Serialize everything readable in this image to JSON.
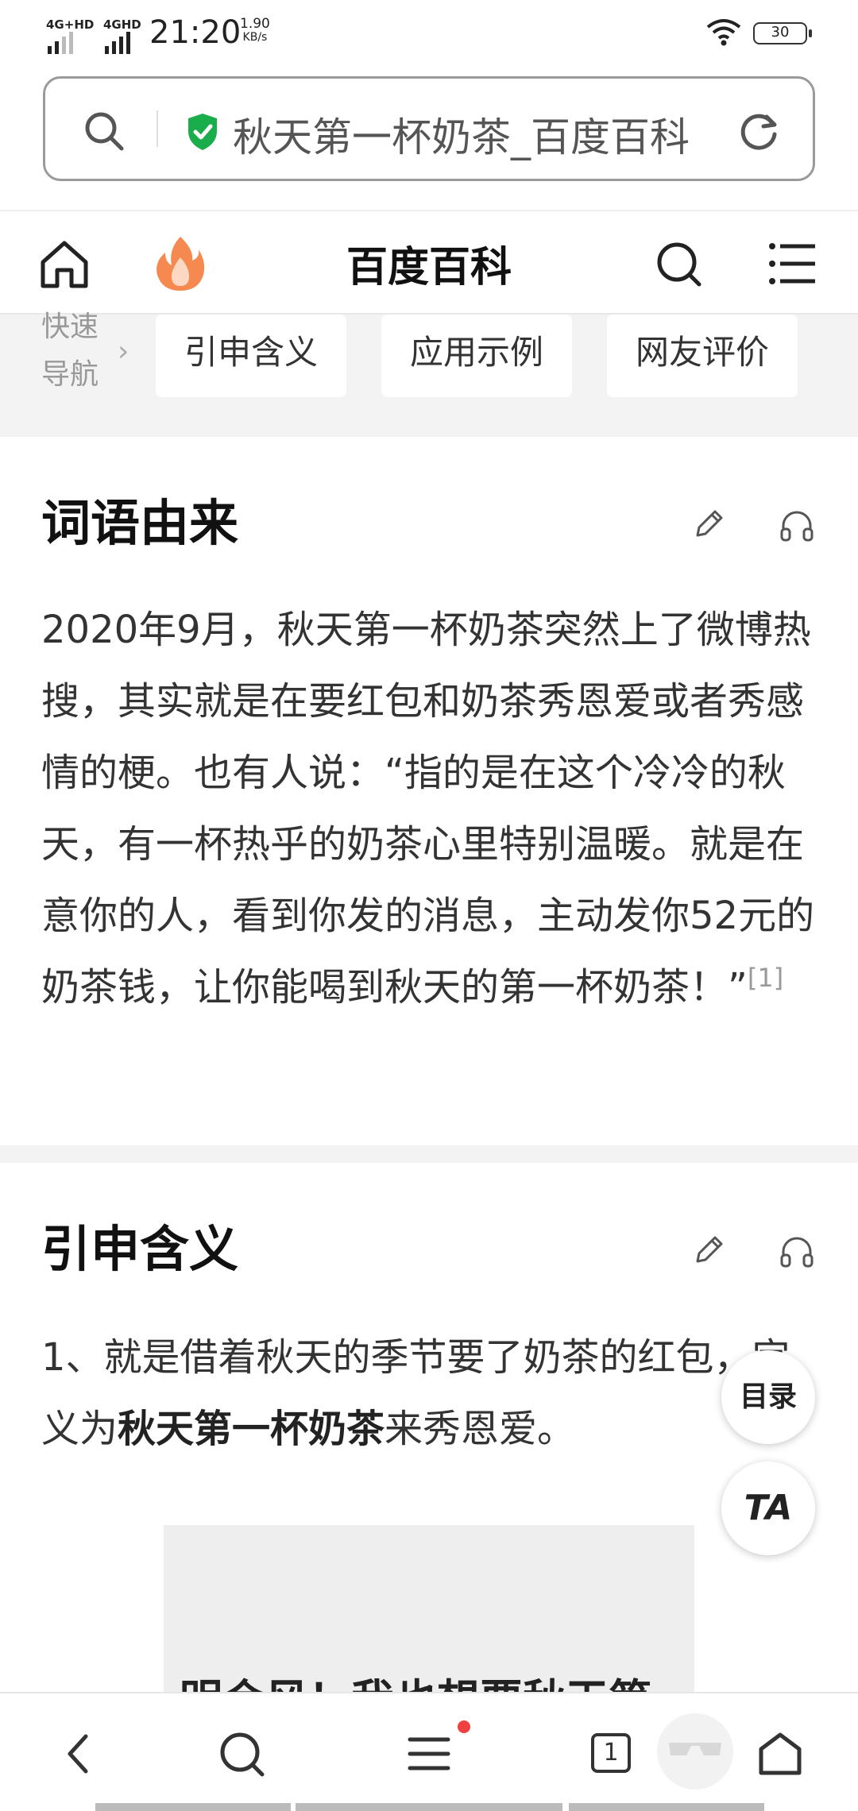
{
  "status_bar": {
    "signal_1": "4G+HD",
    "signal_2": "4GHD",
    "time": "21:20",
    "net_speed": "1.90",
    "net_speed_unit": "KB/s",
    "battery": "30"
  },
  "url_bar": {
    "title": "秋天第一杯奶茶_百度百科"
  },
  "top_nav": {
    "title": "百度百科"
  },
  "quick_nav": {
    "label": "快速导航",
    "items": [
      "引申含义",
      "应用示例",
      "网友评价"
    ]
  },
  "sections": [
    {
      "title": "词语由来",
      "text": "2020年9月，秋天第一杯奶茶突然上了微博热搜，其实就是在要红包和奶茶秀恩爱或者秀感情的梗。也有人说：“指的是在这个冷冷的秋天，有一杯热乎的奶茶心里特别温暖。就是在意你的人，看到你发的消息，主动发你52元的奶茶钱，让你能喝到秋天的第一杯奶茶！”",
      "citation": "[1]"
    },
    {
      "title": "引申含义",
      "text_before": "1、就是借着秋天的季节要了奶茶的红包，定义为",
      "text_bold": "秋天第一杯奶茶",
      "text_after": "来秀恩爱。"
    }
  ],
  "image": {
    "caption": "明会风！我也想要秋天第"
  },
  "floating": {
    "toc": "目录",
    "ta": "TA"
  },
  "bottom_bar": {
    "tab_count": "1"
  }
}
